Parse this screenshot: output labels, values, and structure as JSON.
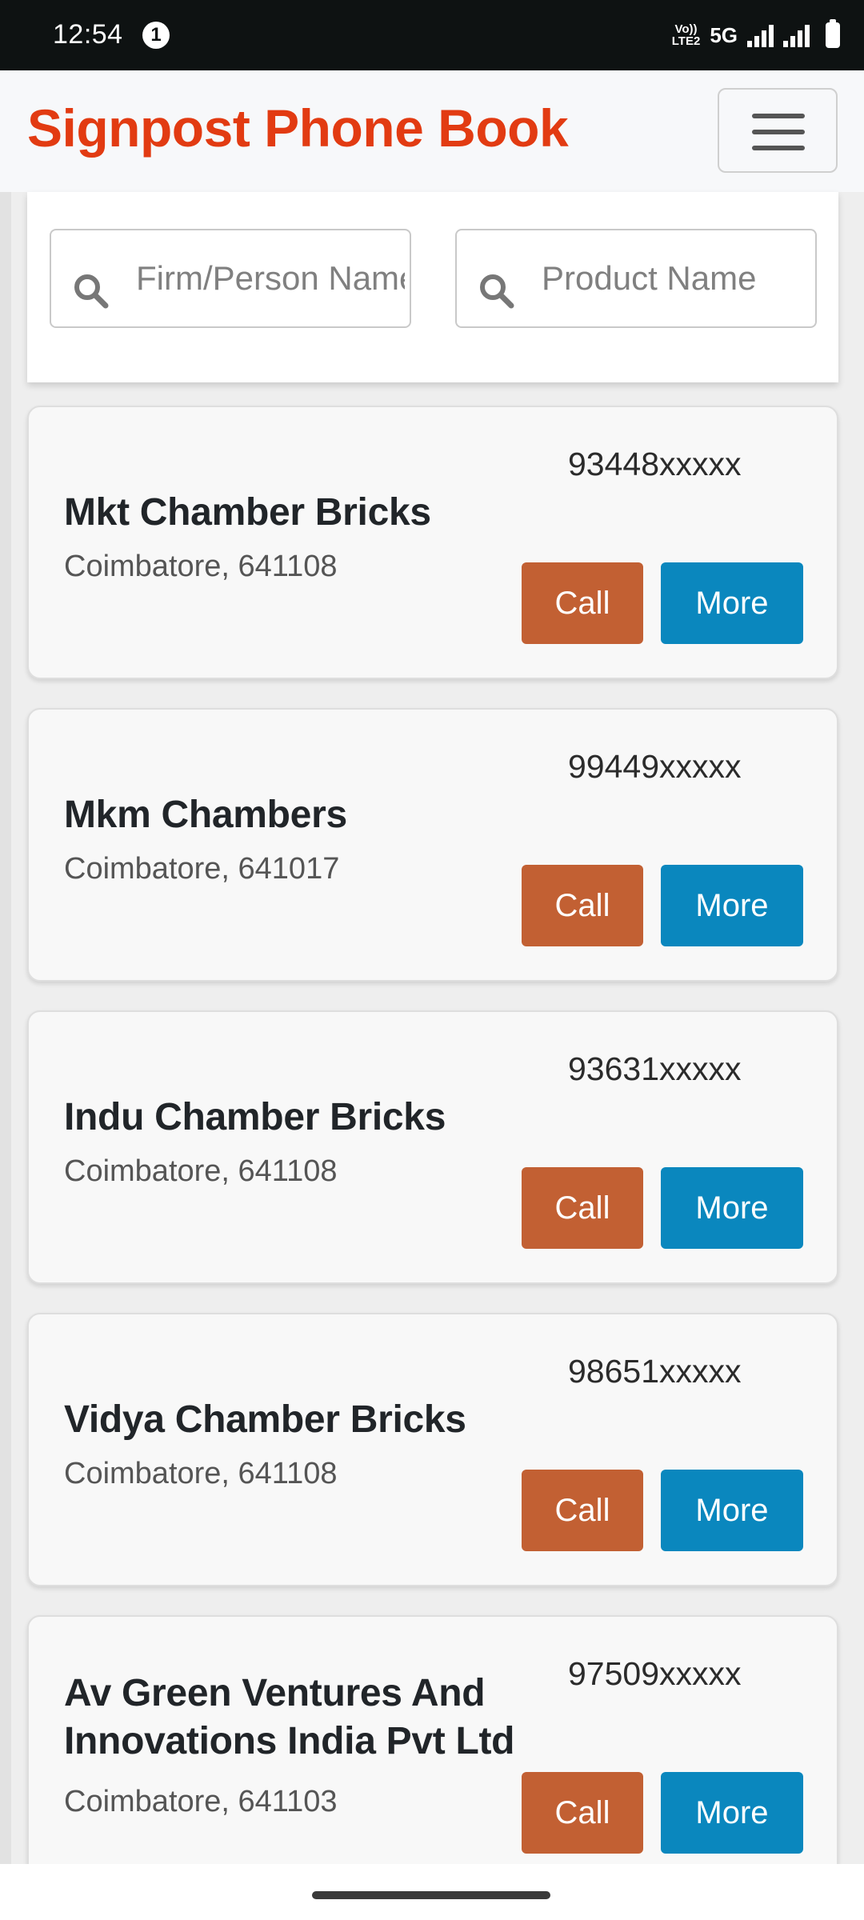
{
  "status_bar": {
    "time": "12:54",
    "notification_count": "1",
    "volte_label_1": "Vo))",
    "volte_label_2": "LTE2",
    "network_type": "5G"
  },
  "header": {
    "brand": "Signpost Phone Book",
    "brand_color": "#e23b12",
    "menu_icon": "hamburger-menu-icon"
  },
  "search": {
    "firm_placeholder": "Firm/Person Name",
    "product_placeholder": "Product Name",
    "icon": "search-icon"
  },
  "colors": {
    "call_button": "#c26033",
    "more_button": "#0a87be"
  },
  "listings": [
    {
      "name": "Mkt Chamber Bricks",
      "location": "Coimbatore, 641108",
      "phone": "93448xxxxx",
      "call_label": "Call",
      "more_label": "More"
    },
    {
      "name": "Mkm Chambers",
      "location": "Coimbatore, 641017",
      "phone": "99449xxxxx",
      "call_label": "Call",
      "more_label": "More"
    },
    {
      "name": "Indu Chamber Bricks",
      "location": "Coimbatore, 641108",
      "phone": "93631xxxxx",
      "call_label": "Call",
      "more_label": "More"
    },
    {
      "name": "Vidya Chamber Bricks",
      "location": "Coimbatore, 641108",
      "phone": "98651xxxxx",
      "call_label": "Call",
      "more_label": "More"
    },
    {
      "name": "Av Green Ventures And Innovations India Pvt Ltd",
      "location": "Coimbatore, 641103",
      "phone": "97509xxxxx",
      "call_label": "Call",
      "more_label": "More"
    }
  ]
}
